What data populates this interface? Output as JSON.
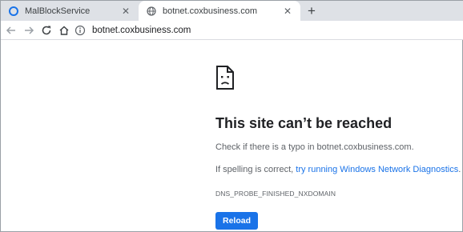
{
  "tabs": [
    {
      "title": "MalBlockService",
      "icon": "malblock-favicon-icon",
      "active": false
    },
    {
      "title": "botnet.coxbusiness.com",
      "icon": "globe-icon",
      "active": true
    }
  ],
  "new_tab_icon": "plus-icon",
  "toolbar": {
    "back_icon": "back-arrow-icon",
    "forward_icon": "forward-arrow-icon",
    "reload_icon": "reload-icon",
    "home_icon": "home-icon",
    "url": "botnet.coxbusiness.com",
    "site_info_icon": "info-icon"
  },
  "error": {
    "icon": "sad-page-icon",
    "title": "This site can’t be reached",
    "line1": "Check if there is a typo in botnet.coxbusiness.com.",
    "line2_prefix": "If spelling is correct, ",
    "line2_link": "try running Windows Network Diagnostics",
    "line2_suffix": ".",
    "code": "DNS_PROBE_FINISHED_NXDOMAIN",
    "reload_label": "Reload"
  },
  "colors": {
    "accent": "#1a73e8",
    "tabstrip": "#dee1e6",
    "text": "#202124",
    "secondary_text": "#5f6368"
  }
}
